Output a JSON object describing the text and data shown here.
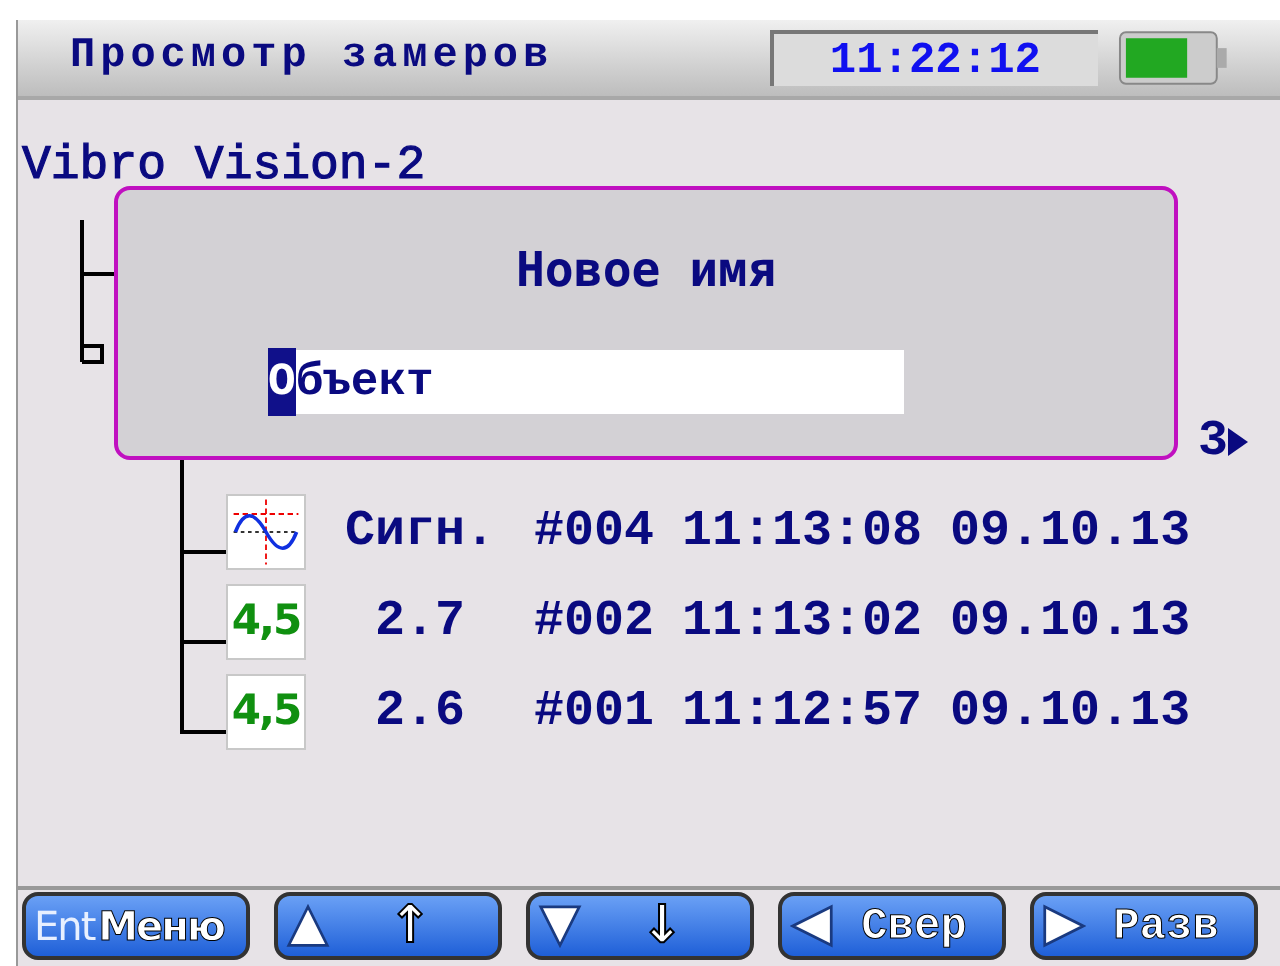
{
  "header": {
    "title": "Просмотр замеров",
    "time": "11:22:12"
  },
  "tree": {
    "root": "Vibro Vision-2",
    "cut_off_text": "3",
    "rows": [
      {
        "kind": "signal",
        "value": "Сигн.",
        "id": "#004",
        "time": "11:13:08",
        "date": "09.10.13"
      },
      {
        "kind": "number",
        "icon_text": "4,5",
        "value": "2.7",
        "id": "#002",
        "time": "11:13:02",
        "date": "09.10.13"
      },
      {
        "kind": "number",
        "icon_text": "4,5",
        "value": "2.6",
        "id": "#001",
        "time": "11:12:57",
        "date": "09.10.13"
      }
    ]
  },
  "dialog": {
    "title": "Новое имя",
    "field": {
      "value": "Объект"
    }
  },
  "softkeys": [
    {
      "kind": "enter",
      "prefix": "Ent",
      "label": "Меню"
    },
    {
      "kind": "up",
      "label": "↑"
    },
    {
      "kind": "down",
      "label": "↓"
    },
    {
      "kind": "left",
      "label": "Свер"
    },
    {
      "kind": "right",
      "label": "Разв"
    }
  ]
}
